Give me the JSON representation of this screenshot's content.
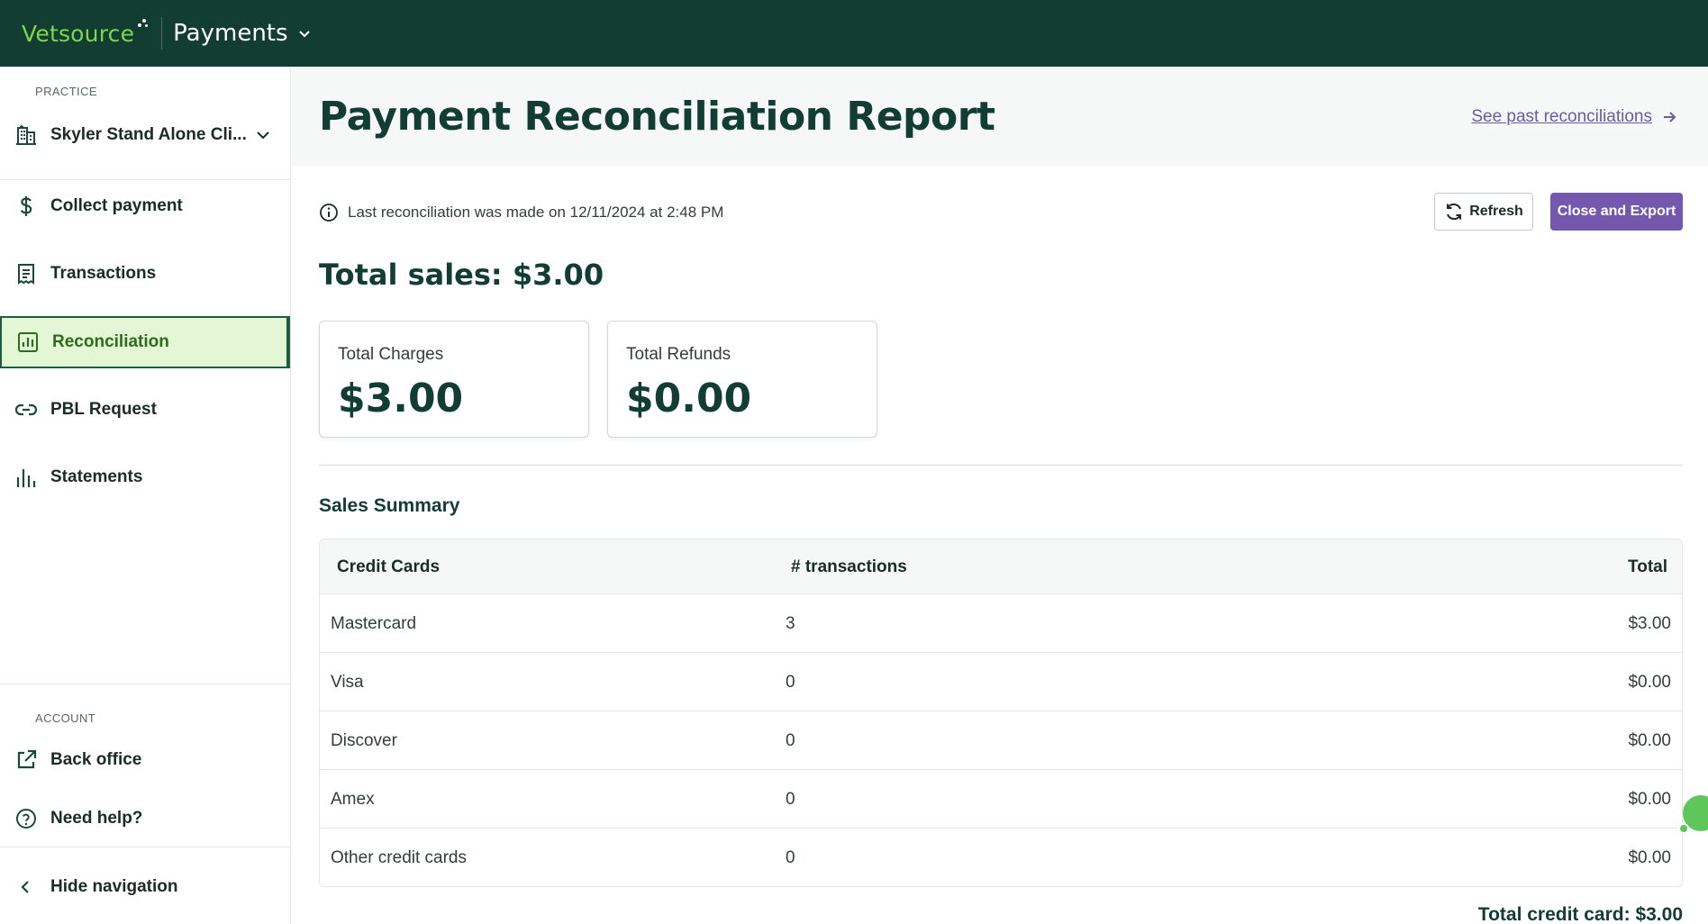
{
  "topbar": {
    "brand": "Vetsource",
    "app_name": "Payments",
    "colors": {
      "bar": "#123d33",
      "brand": "#7fd64a"
    }
  },
  "sidebar": {
    "practice_section": "PRACTICE",
    "practice_name": "Skyler Stand Alone Cli...",
    "items": [
      {
        "label": "Collect payment",
        "icon": "dollar-icon"
      },
      {
        "label": "Transactions",
        "icon": "receipt-icon"
      },
      {
        "label": "Reconciliation",
        "icon": "bar-chart-icon",
        "active": true
      },
      {
        "label": "PBL Request",
        "icon": "link-icon"
      },
      {
        "label": "Statements",
        "icon": "statements-chart-icon"
      }
    ],
    "account_section": "ACCOUNT",
    "account_items": [
      {
        "label": "Back office",
        "icon": "external-link-icon"
      },
      {
        "label": "Need help?",
        "icon": "question-circle-icon"
      }
    ],
    "hide_nav": "Hide navigation"
  },
  "header": {
    "title": "Payment Reconciliation Report",
    "past_link": "See past reconciliations"
  },
  "reconciliation": {
    "last_info": "Last reconciliation was made on 12/11/2024 at 2:48 PM",
    "refresh_label": "Refresh",
    "export_label": "Close and Export",
    "total_sales": "Total sales: $3.00",
    "cards": [
      {
        "label": "Total Charges",
        "value": "$3.00"
      },
      {
        "label": "Total Refunds",
        "value": "$0.00"
      }
    ]
  },
  "sales_summary": {
    "title": "Sales Summary",
    "columns": [
      "Credit Cards",
      "# transactions",
      "Total"
    ],
    "rows": [
      [
        "Mastercard",
        "3",
        "$3.00"
      ],
      [
        "Visa",
        "0",
        "$0.00"
      ],
      [
        "Discover",
        "0",
        "$0.00"
      ],
      [
        "Amex",
        "0",
        "$0.00"
      ],
      [
        "Other credit cards",
        "0",
        "$0.00"
      ]
    ],
    "total_credit": "Total credit card: $3.00"
  }
}
